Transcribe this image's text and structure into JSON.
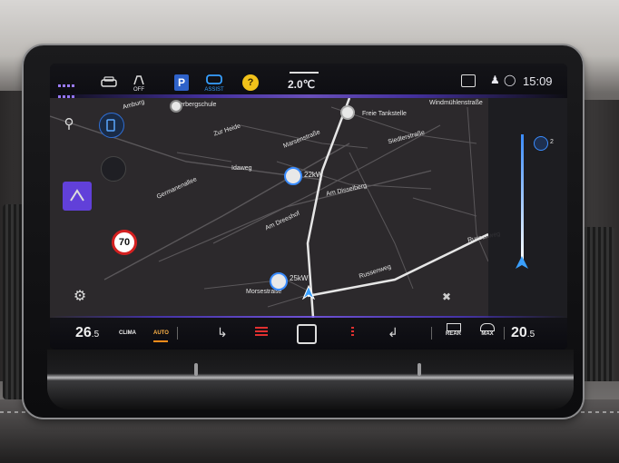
{
  "status_bar": {
    "off_label": "OFF",
    "parking_label": "P",
    "assist_label": "ASSIST",
    "help_label": "?",
    "outside_temp": "2.0℃",
    "time": "15:09"
  },
  "map": {
    "streets": [
      "Overbergschule",
      "Freie Tankstelle",
      "Windmühlenstraße",
      "Zur Heide",
      "Marsenstraße",
      "Siedlerstraße",
      "Idaweg",
      "Germanenallee",
      "Am Disselberg",
      "Am Dreeshof",
      "Russenweg",
      "Russenweg",
      "Morsestraße",
      "Amburg"
    ],
    "charging_1": "22kW",
    "charging_2": "25kW",
    "speed_limit": "70",
    "side_label": "2"
  },
  "climate": {
    "left_temp_int": "26",
    "left_temp_dec": ".5",
    "clima_label": "CLIMA",
    "auto_label": "AUTO",
    "rear_label": "REAR",
    "max_label": "MAX",
    "right_temp_int": "20",
    "right_temp_dec": ".5"
  },
  "colors": {
    "accent": "#6140d9",
    "route": "#e8e8e8",
    "speed_border": "#d42020",
    "charging_ring": "#3a8cff"
  }
}
